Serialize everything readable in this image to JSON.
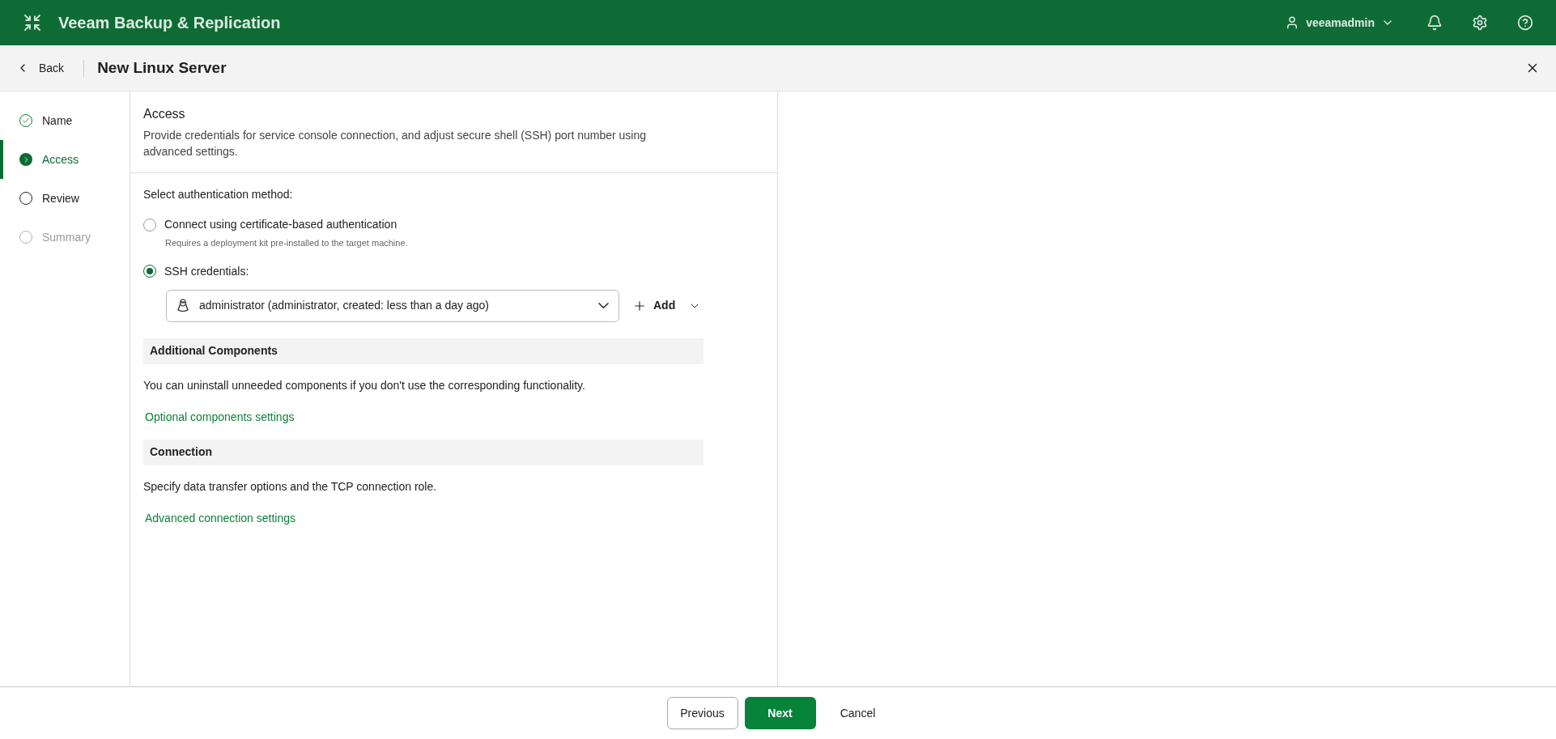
{
  "app": {
    "title": "Veeam Backup & Replication",
    "user": "veeamadmin"
  },
  "wizard": {
    "back": "Back",
    "title": "New Linux Server"
  },
  "steps": [
    {
      "label": "Name",
      "kind": "done",
      "selected": false
    },
    {
      "label": "Access",
      "kind": "current",
      "selected": true
    },
    {
      "label": "Review",
      "kind": "pending",
      "selected": false
    },
    {
      "label": "Summary",
      "kind": "disabled",
      "selected": false
    }
  ],
  "section": {
    "title": "Access",
    "description": "Provide credentials for service console connection, and adjust secure shell (SSH) port number using advanced settings."
  },
  "auth": {
    "label": "Select authentication method:",
    "options": [
      {
        "label": "Connect using certificate-based authentication",
        "hint": "Requires a deployment kit pre-installed to the target machine.",
        "selected": false
      },
      {
        "label": "SSH credentials:",
        "selected": true
      }
    ],
    "credential": "administrator (administrator, created: less than a day ago)",
    "add": "Add"
  },
  "groups": [
    {
      "title": "Additional Components",
      "text": "You can uninstall unneeded components if you don't use the corresponding functionality.",
      "link": "Optional components settings"
    },
    {
      "title": "Connection",
      "text": "Specify data transfer options and the TCP connection role.",
      "link": "Advanced connection settings"
    }
  ],
  "footer": {
    "previous": "Previous",
    "next": "Next",
    "cancel": "Cancel"
  }
}
